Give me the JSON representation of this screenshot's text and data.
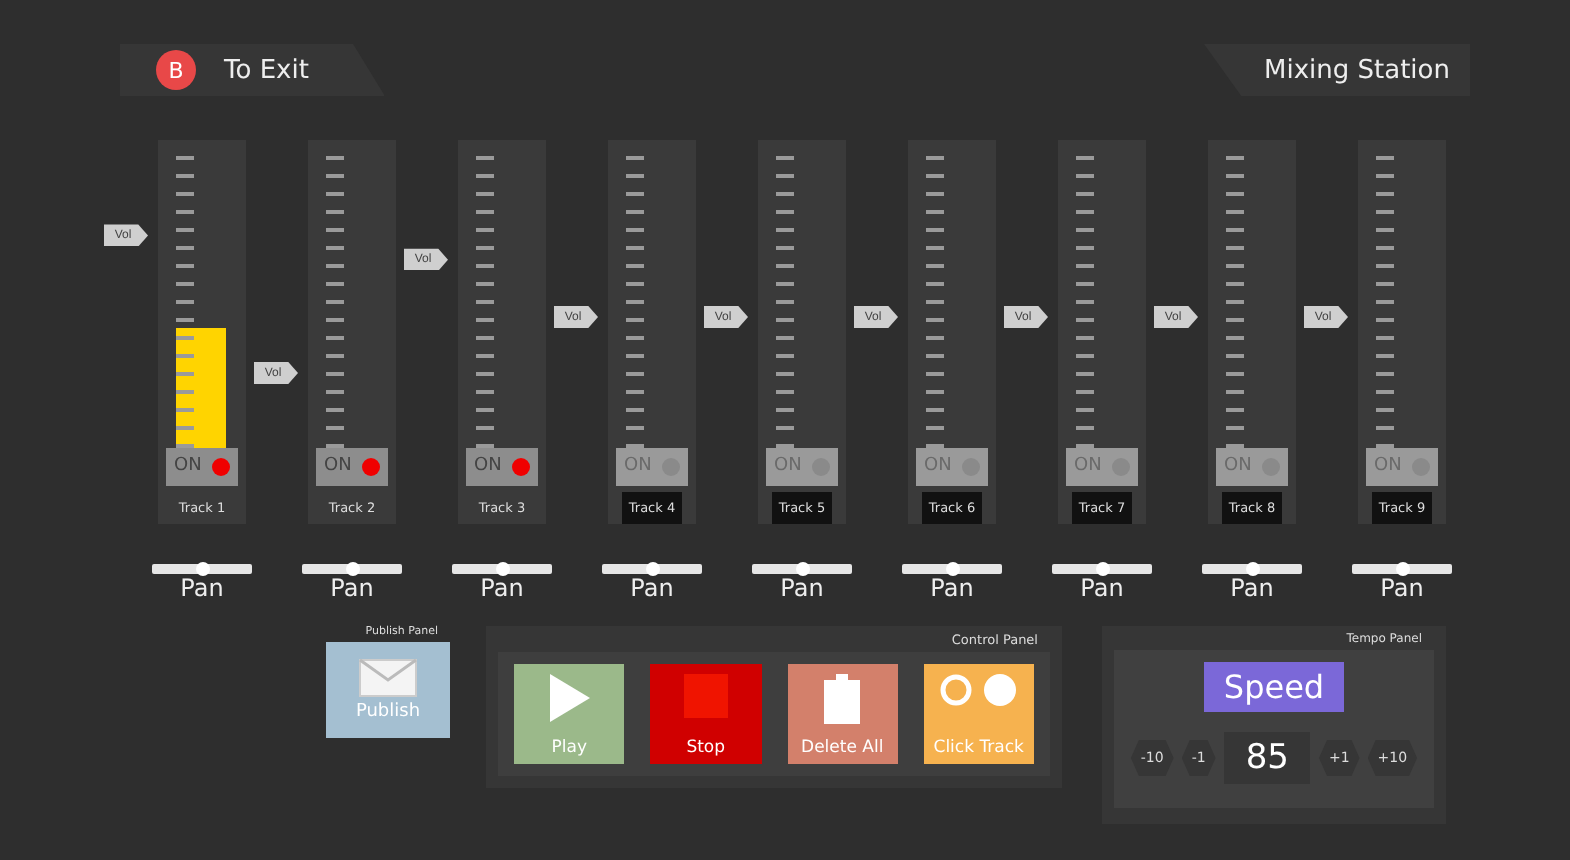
{
  "header": {
    "exit": {
      "key": "B",
      "label": "To Exit"
    },
    "title": "Mixing Station"
  },
  "tracks": [
    {
      "name": "Track 1",
      "on": true,
      "on_label": "ON",
      "volume": {
        "label": "Vol",
        "level": 0.72
      },
      "meter": {
        "level": 0.39
      },
      "pan": {
        "label": "Pan",
        "level": 0.5
      }
    },
    {
      "name": "Track 2",
      "on": true,
      "on_label": "ON",
      "volume": {
        "label": "Vol"
      },
      "pan": {
        "label": "Pan",
        "level": 0.5
      }
    },
    {
      "name": "Track 3",
      "on": true,
      "on_label": "ON",
      "volume": {
        "label": "Vol",
        "level": 0.64
      },
      "pan": {
        "label": "Pan",
        "level": 0.5
      }
    },
    {
      "name": "Track 4",
      "on": false,
      "on_label": "ON",
      "volume": {
        "label": "Vol"
      },
      "pan": {
        "label": "Pan",
        "level": 0.5
      }
    },
    {
      "name": "Track 5",
      "on": false,
      "on_label": "ON",
      "volume": {
        "label": "Vol"
      },
      "pan": {
        "label": "Pan",
        "level": 0.5
      }
    },
    {
      "name": "Track 6",
      "on": false,
      "on_label": "ON",
      "volume": {
        "label": "Vol"
      },
      "pan": {
        "label": "Pan",
        "level": 0.5
      }
    },
    {
      "name": "Track 7",
      "on": false,
      "on_label": "ON",
      "volume": {
        "label": "Vol"
      },
      "pan": {
        "label": "Pan",
        "level": 0.5
      }
    },
    {
      "name": "Track 8",
      "on": false,
      "on_label": "ON",
      "volume": {
        "label": "Vol"
      },
      "pan": {
        "label": "Pan",
        "level": 0.5
      }
    },
    {
      "name": "Track 9",
      "on": false,
      "on_label": "ON",
      "volume": {
        "label": "Vol"
      },
      "pan": {
        "label": "Pan",
        "level": 0.5
      }
    }
  ],
  "publish_panel": {
    "title": "Publish Panel",
    "button": "Publish"
  },
  "control_panel": {
    "title": "Control Panel",
    "buttons": [
      {
        "kind": "play",
        "label": "Play"
      },
      {
        "kind": "stop",
        "label": "Stop"
      },
      {
        "kind": "delete",
        "label": "Delete All"
      },
      {
        "kind": "click",
        "label": "Click Track"
      }
    ]
  },
  "tempo_panel": {
    "title": "Tempo Panel",
    "label": "Speed",
    "value": "85",
    "steps": [
      "-10",
      "-1",
      "+1",
      "+10"
    ]
  }
}
